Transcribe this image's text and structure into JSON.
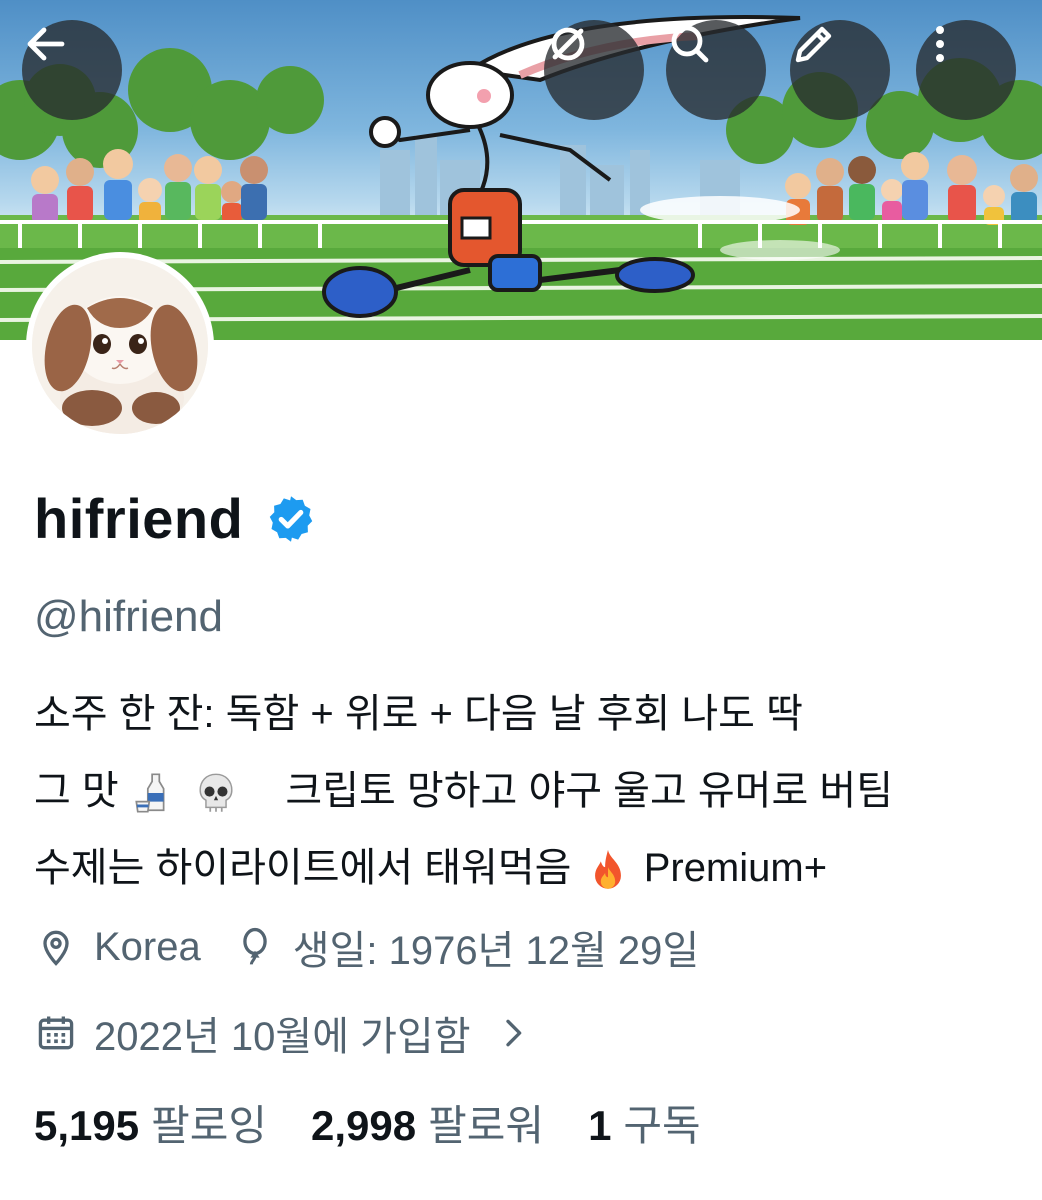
{
  "profile": {
    "display_name": "hifriend",
    "handle": "@hifriend",
    "verified": true
  },
  "bio": {
    "line1": "소주 한 잔: 독함 + 위로 + 다음 날 후회   나도 딱",
    "line2_start": "그 맛",
    "line2_end": "크립토 망하고 야구 울고 유머로 버팀",
    "line3_start": "수제는 하이라이트에서 태워먹음",
    "line3_end": "Premium+"
  },
  "meta": {
    "location": "Korea",
    "birthday": "생일: 1976년 12월 29일",
    "joined": "2022년 10월에 가입함"
  },
  "stats": {
    "following_count": "5,195",
    "following_label": "팔로잉",
    "followers_count": "2,998",
    "followers_label": "팔로워",
    "subscriptions_count": "1",
    "subscriptions_label": "구독"
  },
  "icons": {
    "back": "back-arrow-icon",
    "hide": "eye-slash-icon",
    "search": "search-icon",
    "edit": "pencil-icon",
    "more": "more-vertical-icon",
    "location": "location-pin-icon",
    "birthday": "balloon-icon",
    "calendar": "calendar-icon",
    "chevron": "chevron-right-icon",
    "bio_emoji_1": "sake-emoji",
    "bio_emoji_2": "skull-emoji",
    "bio_emoji_3": "fire-emoji"
  },
  "colors": {
    "verified_blue": "#1d9bf0",
    "secondary_text": "#536471",
    "primary_text": "#0f1419",
    "button_overlay": "#282c30"
  }
}
